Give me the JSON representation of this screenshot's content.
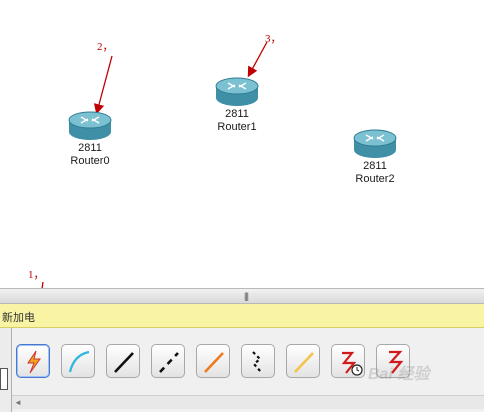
{
  "workspace": {
    "routers": [
      {
        "model": "2811",
        "name": "Router0"
      },
      {
        "model": "2811",
        "name": "Router1"
      },
      {
        "model": "2811",
        "name": "Router2"
      }
    ],
    "annotations": [
      "1，",
      "2，",
      "3，"
    ]
  },
  "panel": {
    "grip": "|||",
    "title": "新加电"
  },
  "toolbar": {
    "tools": [
      {
        "icon": "automatic-connection-icon",
        "selected": true
      },
      {
        "icon": "console-cable-icon"
      },
      {
        "icon": "copper-straight-through-icon"
      },
      {
        "icon": "copper-cross-over-icon"
      },
      {
        "icon": "fiber-cable-icon"
      },
      {
        "icon": "phone-cable-icon"
      },
      {
        "icon": "coaxial-cable-icon"
      },
      {
        "icon": "serial-dce-icon"
      },
      {
        "icon": "serial-dte-icon"
      }
    ],
    "scroll_arrow": "◄"
  },
  "watermark": "Bai 经验",
  "colors": {
    "router_top": "#6fb6c8",
    "router_body": "#3f8fa6",
    "annotation": "#c00000",
    "title_bar": "#f8f4a3",
    "selected_border": "#4a78c9"
  }
}
